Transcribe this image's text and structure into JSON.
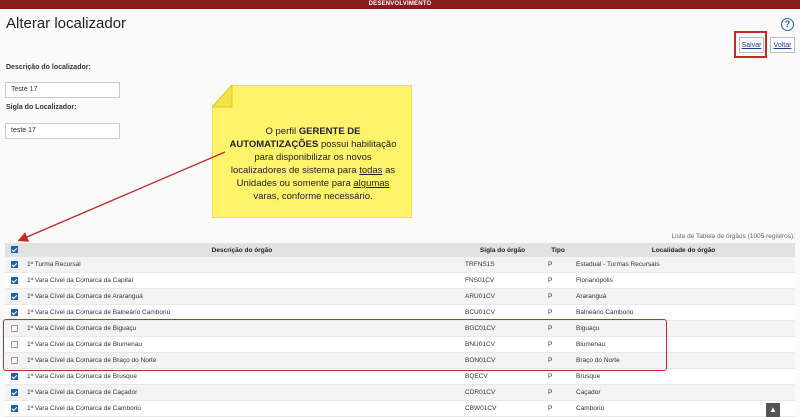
{
  "env_banner": "DESENVOLVIMENTO",
  "page_title": "Alterar localizador",
  "help_glyph": "?",
  "toolbar": {
    "save_label": "Salvar",
    "back_label": "Voltar"
  },
  "form": {
    "descricao_label": "Descrição do localizador:",
    "descricao_value": "Teste 17",
    "sigla_label": "Sigla do Localizador:",
    "sigla_value": "teste 17"
  },
  "note": {
    "part1": "O perfil ",
    "bold": "GERENTE DE AUTOMATIZAÇÕES",
    "part2": " possui habilitação para disponibilizar os novos localizadores de sistema para ",
    "u1": "todas",
    "part3": " as Unidades ou somente para ",
    "u2": "algumas",
    "part4": " varas, conforme necessário."
  },
  "table": {
    "caption": "Lista de Tabela de órgãos (1005 registros):",
    "headers": {
      "descricao": "Descrição do órgão",
      "sigla": "Sigla do órgão",
      "tipo": "Tipo",
      "localidade": "Localidade do órgão"
    },
    "rows": [
      {
        "checked": true,
        "descricao": "1ª Turma Recursal",
        "sigla": "TRFNS1S",
        "tipo": "P",
        "localidade": "Estadual - Turmas Recursais"
      },
      {
        "checked": true,
        "descricao": "1ª Vara Cível da Comarca da Capital",
        "sigla": "FNS01CV",
        "tipo": "P",
        "localidade": "Florianópolis"
      },
      {
        "checked": true,
        "descricao": "1ª Vara Cível da Comarca de Araranguá",
        "sigla": "ARU01CV",
        "tipo": "P",
        "localidade": "Araranguá"
      },
      {
        "checked": true,
        "descricao": "1ª Vara Cível da Comarca de Balneário Camboriú",
        "sigla": "BCU01CV",
        "tipo": "P",
        "localidade": "Balneário Camboriú"
      },
      {
        "checked": false,
        "descricao": "1ª Vara Cível da Comarca de Biguaçu",
        "sigla": "BGC01CV",
        "tipo": "P",
        "localidade": "Biguaçu"
      },
      {
        "checked": false,
        "descricao": "1ª Vara Cível da Comarca de Blumenau",
        "sigla": "BNU01CV",
        "tipo": "P",
        "localidade": "Blumenau"
      },
      {
        "checked": false,
        "descricao": "1ª Vara Cível da Comarca de Braço do Norte",
        "sigla": "BON01CV",
        "tipo": "P",
        "localidade": "Braço do Norte"
      },
      {
        "checked": true,
        "descricao": "1ª Vara Cível da Comarca de Brusque",
        "sigla": "BQECV",
        "tipo": "P",
        "localidade": "Brusque"
      },
      {
        "checked": true,
        "descricao": "1ª Vara Cível da Comarca de Caçador",
        "sigla": "CDR01CV",
        "tipo": "P",
        "localidade": "Caçador"
      },
      {
        "checked": true,
        "descricao": "1ª Vara Cível da Comarca de Camboriú",
        "sigla": "CBW01CV",
        "tipo": "P",
        "localidade": "Camboriú"
      }
    ]
  },
  "scroll_top_glyph": "▲",
  "colors": {
    "banner": "#8b1a1a",
    "highlight": "#c62828",
    "sticky_note": "#fff36b",
    "checkbox": "#1e5fb4"
  }
}
